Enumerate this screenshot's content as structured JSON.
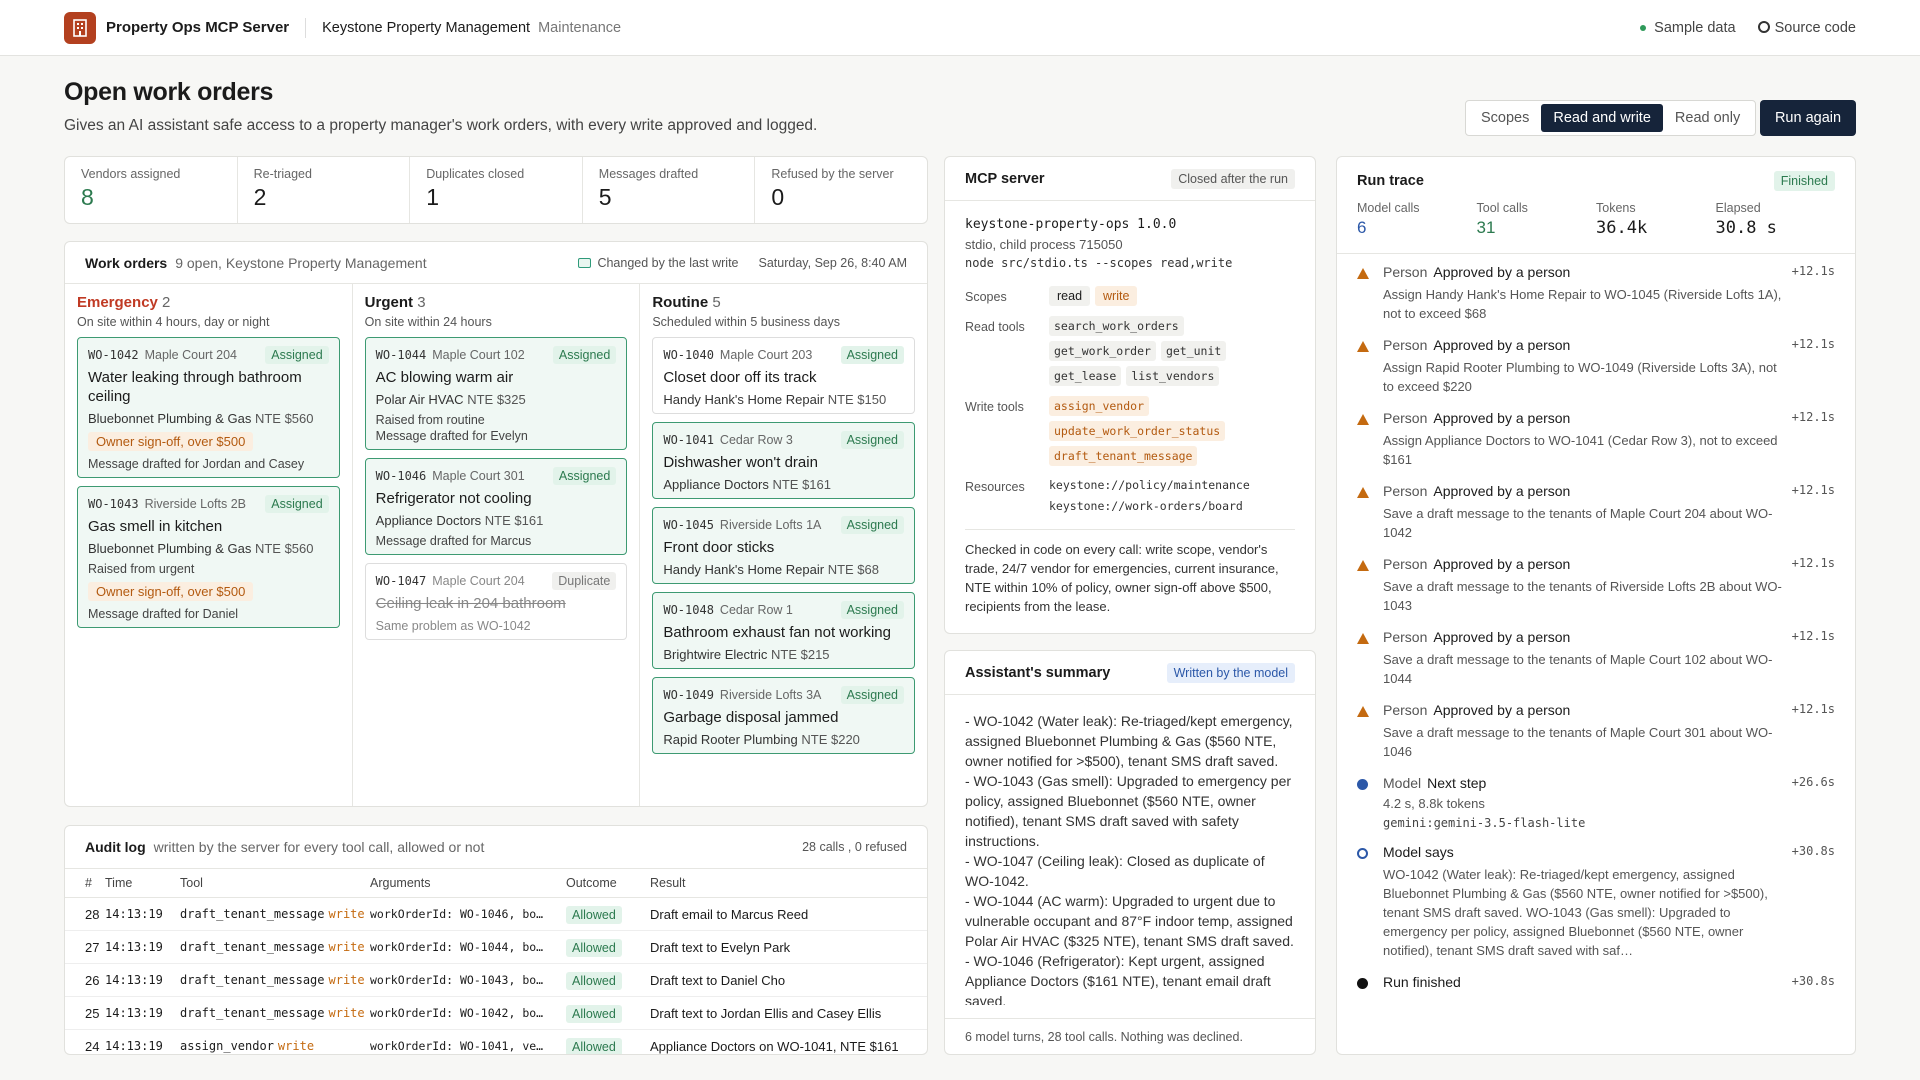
{
  "header": {
    "app": "Property Ops MCP Server",
    "org": "Keystone Property Management",
    "org_sub": "Maintenance",
    "sample": "Sample data",
    "source": "Source code"
  },
  "page": {
    "title": "Open work orders",
    "subtitle": "Gives an AI assistant safe access to a property manager's work orders, with every write approved and logged."
  },
  "scopes": {
    "label": "Scopes",
    "opt1": "Read and write",
    "opt2": "Read only",
    "run": "Run again"
  },
  "stats": [
    {
      "label": "Vendors assigned",
      "value": "8"
    },
    {
      "label": "Re-triaged",
      "value": "2"
    },
    {
      "label": "Duplicates closed",
      "value": "1"
    },
    {
      "label": "Messages drafted",
      "value": "5"
    },
    {
      "label": "Refused by the server",
      "value": "0"
    }
  ],
  "work_orders": {
    "title": "Work orders",
    "sub": "9 open, Keystone Property Management",
    "changed": "Changed by the last write",
    "date": "Saturday, Sep 26, 8:40 AM",
    "cols": [
      {
        "title": "Emergency",
        "count": "2",
        "sub": "On site within 4 hours, day or night",
        "items": [
          {
            "id": "WO-1042",
            "place": "Maple Court 204",
            "badge": "Assigned",
            "title": "Water leaking through bathroom ceiling",
            "vendor": "Bluebonnet Plumbing & Gas",
            "nte": "NTE $560",
            "owner": "Owner sign-off, over $500",
            "note": "Message drafted for Jordan and Casey"
          },
          {
            "id": "WO-1043",
            "place": "Riverside Lofts 2B",
            "badge": "Assigned",
            "title": "Gas smell in kitchen",
            "vendor": "Bluebonnet Plumbing & Gas",
            "nte": "NTE $560",
            "raised": "Raised from urgent",
            "owner": "Owner sign-off, over $500",
            "note": "Message drafted for Daniel"
          }
        ]
      },
      {
        "title": "Urgent",
        "count": "3",
        "sub": "On site within 24 hours",
        "items": [
          {
            "id": "WO-1044",
            "place": "Maple Court 102",
            "badge": "Assigned",
            "title": "AC blowing warm air",
            "vendor": "Polar Air HVAC",
            "nte": "NTE $325",
            "raised": "Raised from routine",
            "note": "Message drafted for Evelyn"
          },
          {
            "id": "WO-1046",
            "place": "Maple Court 301",
            "badge": "Assigned",
            "title": "Refrigerator not cooling",
            "vendor": "Appliance Doctors",
            "nte": "NTE $161",
            "note": "Message drafted for Marcus"
          },
          {
            "id": "WO-1047",
            "place": "Maple Court 204",
            "badge": "Duplicate",
            "title": "Ceiling leak in 204 bathroom",
            "note": "Same problem as WO-1042"
          }
        ]
      },
      {
        "title": "Routine",
        "count": "5",
        "sub": "Scheduled within 5 business days",
        "items": [
          {
            "id": "WO-1040",
            "place": "Maple Court 203",
            "badge": "Assigned",
            "title": "Closet door off its track",
            "vendor": "Handy Hank's Home Repair",
            "nte": "NTE $150"
          },
          {
            "id": "WO-1041",
            "place": "Cedar Row 3",
            "badge": "Assigned",
            "title": "Dishwasher won't drain",
            "vendor": "Appliance Doctors",
            "nte": "NTE $161"
          },
          {
            "id": "WO-1045",
            "place": "Riverside Lofts 1A",
            "badge": "Assigned",
            "title": "Front door sticks",
            "vendor": "Handy Hank's Home Repair",
            "nte": "NTE $68"
          },
          {
            "id": "WO-1048",
            "place": "Cedar Row 1",
            "badge": "Assigned",
            "title": "Bathroom exhaust fan not working",
            "vendor": "Brightwire Electric",
            "nte": "NTE $215"
          },
          {
            "id": "WO-1049",
            "place": "Riverside Lofts 3A",
            "badge": "Assigned",
            "title": "Garbage disposal jammed",
            "vendor": "Rapid Rooter Plumbing",
            "nte": "NTE $220"
          }
        ]
      }
    ]
  },
  "audit": {
    "title": "Audit log",
    "sub": "written by the server for every tool call, allowed or not",
    "calls": "28 calls",
    "refused": "0 refused",
    "headers": [
      "#",
      "Time",
      "Tool",
      "Arguments",
      "Outcome",
      "Result"
    ],
    "rows": [
      {
        "n": "28",
        "time": "14:13:19",
        "tool": "draft_tenant_message",
        "scope": "write",
        "args": "workOrderId: WO-1046, bo…",
        "outcome": "Allowed",
        "result": "Draft email to Marcus Reed"
      },
      {
        "n": "27",
        "time": "14:13:19",
        "tool": "draft_tenant_message",
        "scope": "write",
        "args": "workOrderId: WO-1044, bo…",
        "outcome": "Allowed",
        "result": "Draft text to Evelyn Park"
      },
      {
        "n": "26",
        "time": "14:13:19",
        "tool": "draft_tenant_message",
        "scope": "write",
        "args": "workOrderId: WO-1043, bo…",
        "outcome": "Allowed",
        "result": "Draft text to Daniel Cho"
      },
      {
        "n": "25",
        "time": "14:13:19",
        "tool": "draft_tenant_message",
        "scope": "write",
        "args": "workOrderId: WO-1042, bo…",
        "outcome": "Allowed",
        "result": "Draft text to Jordan Ellis and Casey Ellis"
      },
      {
        "n": "24",
        "time": "14:13:19",
        "tool": "assign_vendor",
        "scope": "write",
        "args": "workOrderId: WO-1041, ve…",
        "outcome": "Allowed",
        "result": "Appliance Doctors on WO-1041, NTE $161"
      }
    ]
  },
  "mcp": {
    "title": "MCP server",
    "chip": "Closed after the run",
    "name": "keystone-property-ops 1.0.0",
    "proc": "stdio, child process 715050",
    "cmd": "node src/stdio.ts --scopes read,write",
    "scopes_label": "Scopes",
    "scope_read": "read",
    "scope_write": "write",
    "read_label": "Read tools",
    "read_tools": [
      "search_work_orders",
      "get_work_order",
      "get_unit",
      "get_lease",
      "list_vendors"
    ],
    "write_label": "Write tools",
    "write_tools": [
      "assign_vendor",
      "update_work_order_status",
      "draft_tenant_message"
    ],
    "res_label": "Resources",
    "resources": [
      "keystone://policy/maintenance",
      "keystone://work-orders/board"
    ],
    "checked": "Checked in code on every call: write scope, vendor's trade, 24/7 vendor for emergencies, current insurance, NTE within 10% of policy, owner sign-off above $500, recipients from the lease."
  },
  "summary": {
    "title": "Assistant's summary",
    "chip": "Written by the model",
    "lines": [
      "- WO-1042 (Water leak): Re-triaged/kept emergency, assigned Bluebonnet Plumbing & Gas ($560 NTE, owner notified for >$500), tenant SMS draft saved.",
      "- WO-1043 (Gas smell): Upgraded to emergency per policy, assigned Bluebonnet ($560 NTE, owner notified), tenant SMS draft saved with safety instructions.",
      "- WO-1047 (Ceiling leak): Closed as duplicate of WO-1042.",
      "- WO-1044 (AC warm): Upgraded to urgent due to vulnerable occupant and 87°F indoor temp, assigned Polar Air HVAC ($325 NTE), tenant SMS draft saved.",
      "- WO-1046 (Refrigerator): Kept urgent, assigned Appliance Doctors ($161 NTE), tenant email draft saved."
    ],
    "foot": "6 model turns, 28 tool calls. Nothing was declined."
  },
  "trace": {
    "title": "Run trace",
    "chip": "Finished",
    "stats": [
      {
        "label": "Model calls",
        "value": "6"
      },
      {
        "label": "Tool calls",
        "value": "31"
      },
      {
        "label": "Tokens",
        "value": "36.4k"
      },
      {
        "label": "Elapsed",
        "value": "30.8 s"
      }
    ],
    "events": [
      {
        "who": "Person",
        "what": "Approved by a person",
        "ts": "+12.1s",
        "desc": "Assign Handy Hank's Home Repair to WO-1045 (Riverside Lofts 1A), not to exceed $68"
      },
      {
        "who": "Person",
        "what": "Approved by a person",
        "ts": "+12.1s",
        "desc": "Assign Rapid Rooter Plumbing to WO-1049 (Riverside Lofts 3A), not to exceed $220"
      },
      {
        "who": "Person",
        "what": "Approved by a person",
        "ts": "+12.1s",
        "desc": "Assign Appliance Doctors to WO-1041 (Cedar Row 3), not to exceed $161"
      },
      {
        "who": "Person",
        "what": "Approved by a person",
        "ts": "+12.1s",
        "desc": "Save a draft message to the tenants of Maple Court 204 about WO-1042"
      },
      {
        "who": "Person",
        "what": "Approved by a person",
        "ts": "+12.1s",
        "desc": "Save a draft message to the tenants of Riverside Lofts 2B about WO-1043"
      },
      {
        "who": "Person",
        "what": "Approved by a person",
        "ts": "+12.1s",
        "desc": "Save a draft message to the tenants of Maple Court 102 about WO-1044"
      },
      {
        "who": "Person",
        "what": "Approved by a person",
        "ts": "+12.1s",
        "desc": "Save a draft message to the tenants of Maple Court 301 about WO-1046"
      }
    ],
    "next": {
      "who": "Model",
      "what": "Next step",
      "ts": "+26.6s",
      "desc": "4.2 s, 8.8k tokens",
      "model": "gemini:gemini-3.5-flash-lite"
    },
    "says": {
      "what": "Model says",
      "ts": "+30.8s",
      "desc": "WO-1042 (Water leak): Re-triaged/kept emergency, assigned Bluebonnet Plumbing & Gas ($560 NTE, owner notified for >$500), tenant SMS draft saved. WO-1043 (Gas smell): Upgraded to emergency per policy, assigned Bluebonnet ($560 NTE, owner notified), tenant SMS draft saved with saf…"
    },
    "done": {
      "what": "Run finished",
      "ts": "+30.8s"
    }
  }
}
